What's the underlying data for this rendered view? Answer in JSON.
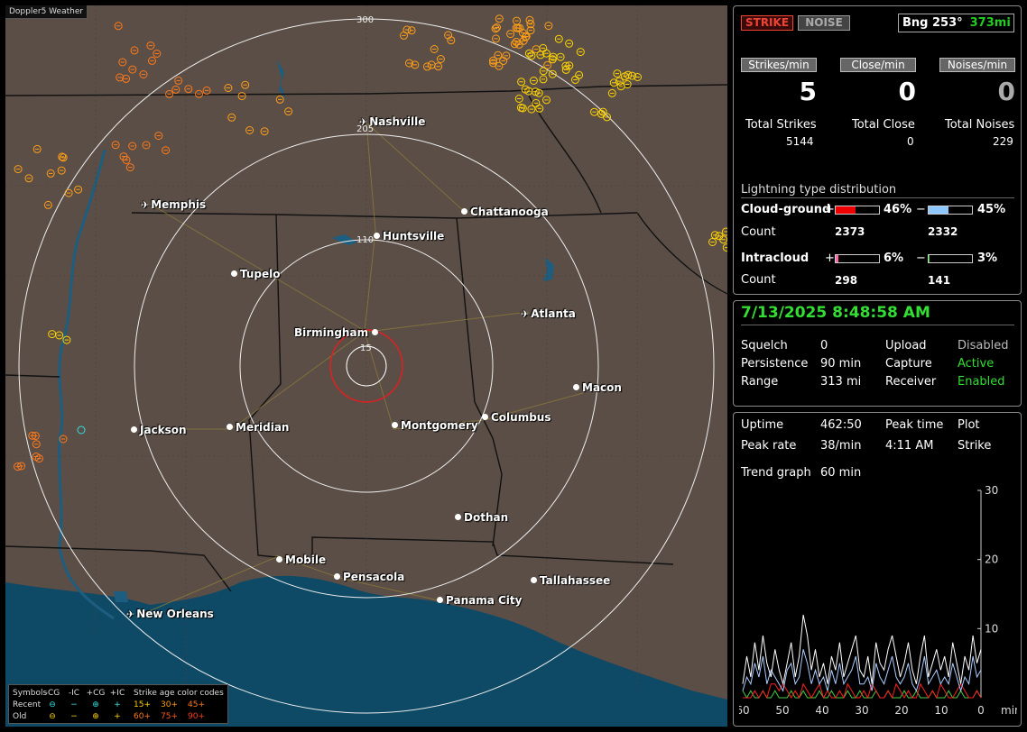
{
  "app_title": "Doppler5 Weather",
  "cities": {
    "nashville": "Nashville",
    "memphis": "Memphis",
    "chattanooga": "Chattanooga",
    "huntsville": "Huntsville",
    "tupelo": "Tupelo",
    "birmingham": "Birmingham",
    "atlanta": "Atlanta",
    "macon": "Macon",
    "jackson": "Jackson",
    "meridian": "Meridian",
    "montgomery": "Montgomery",
    "columbus": "Columbus",
    "dothan": "Dothan",
    "mobile": "Mobile",
    "pensacola": "Pensacola",
    "tallahassee": "Tallahassee",
    "panama_city": "Panama City",
    "new_orleans": "New Orleans"
  },
  "rings": {
    "r15": "15",
    "r110": "110",
    "r205": "205",
    "r300": "300"
  },
  "legend": {
    "header": [
      "Symbols",
      "-CG",
      "-IC",
      "+CG",
      "+IC",
      "Strike age color codes"
    ],
    "recent_label": "Recent",
    "old_label": "Old",
    "recent_ages": [
      "15+",
      "30+",
      "45+"
    ],
    "old_ages": [
      "60+",
      "75+",
      "90+"
    ],
    "symbols": {
      "neg_cg": "⊖",
      "neg_ic": "−",
      "pos_cg": "⊕",
      "pos_ic": "+"
    }
  },
  "colors": {
    "age15": "#ffd400",
    "age30": "#ff9e18",
    "age45": "#ff7a1a",
    "recent_sym": "#33e0e0",
    "old_sym": "#ffd400",
    "strike_dot": "#ff9e18"
  },
  "status": {
    "strike_btn": "STRIKE",
    "noise_btn": "NOISE",
    "bearing_label": "Bng 253°",
    "bearing_dist": "373mi"
  },
  "rates": {
    "strikes_per_min_label": "Strikes/min",
    "close_per_min_label": "Close/min",
    "noises_per_min_label": "Noises/min",
    "strikes_per_min": "5",
    "close_per_min": "0",
    "noises_per_min": "0",
    "total_strikes_label": "Total Strikes",
    "total_close_label": "Total Close",
    "total_noises_label": "Total Noises",
    "total_strikes": "5144",
    "total_close": "0",
    "total_noises": "229"
  },
  "distribution": {
    "title": "Lightning type distribution",
    "cg_label": "Cloud-ground",
    "ic_label": "Intracloud",
    "count_label": "Count",
    "plus": "+",
    "minus": "−",
    "cg_pos_pct": "46%",
    "cg_neg_pct": "45%",
    "ic_pos_pct": "6%",
    "ic_neg_pct": "3%",
    "cg_pos_frac": 0.46,
    "cg_neg_frac": 0.45,
    "ic_pos_frac": 0.06,
    "ic_neg_frac": 0.03,
    "cg_pos_count": "2373",
    "cg_neg_count": "2332",
    "ic_pos_count": "298",
    "ic_neg_count": "141"
  },
  "settings": {
    "datetime": "7/13/2025 8:48:58 AM",
    "squelch_label": "Squelch",
    "squelch": "0",
    "persistence_label": "Persistence",
    "persistence": "90 min",
    "range_label": "Range",
    "range": "313 mi",
    "upload_label": "Upload",
    "upload": "Disabled",
    "capture_label": "Capture",
    "capture": "Active",
    "receiver_label": "Receiver",
    "receiver": "Enabled"
  },
  "stats": {
    "uptime_label": "Uptime",
    "uptime": "462:50",
    "peak_time_label": "Peak time",
    "peak_time": "4:11 AM",
    "plot_label": "Plot",
    "plot": "Strike",
    "peak_rate_label": "Peak rate",
    "peak_rate": "38/min",
    "trend_label": "Trend graph",
    "trend": "60 min"
  },
  "chart_data": {
    "type": "line",
    "x_ticks": [
      "60",
      "50",
      "40",
      "30",
      "20",
      "10",
      "0"
    ],
    "x_unit": "min",
    "y_ticks": [
      "30",
      "20",
      "10"
    ],
    "ylim": [
      0,
      30
    ],
    "xlim": [
      60,
      0
    ],
    "series": [
      {
        "color": "#ffffff",
        "values": [
          2,
          6,
          3,
          8,
          4,
          9,
          5,
          3,
          7,
          4,
          2,
          5,
          8,
          3,
          6,
          12,
          9,
          4,
          7,
          3,
          5,
          2,
          6,
          4,
          8,
          3,
          5,
          7,
          9,
          4,
          3,
          6,
          2,
          8,
          5,
          4,
          7,
          9,
          6,
          3,
          5,
          8,
          4,
          2,
          6,
          9,
          3,
          5,
          7,
          4,
          6,
          3,
          8,
          5,
          2,
          6,
          4,
          9,
          5,
          7
        ]
      },
      {
        "color": "#aaccff",
        "values": [
          1,
          3,
          2,
          5,
          3,
          6,
          2,
          4,
          3,
          2,
          1,
          4,
          5,
          2,
          3,
          7,
          5,
          2,
          4,
          2,
          3,
          1,
          4,
          2,
          5,
          2,
          3,
          4,
          6,
          2,
          2,
          3,
          1,
          5,
          3,
          2,
          4,
          6,
          3,
          2,
          3,
          5,
          2,
          1,
          3,
          6,
          2,
          3,
          4,
          2,
          3,
          2,
          5,
          3,
          1,
          3,
          2,
          6,
          3,
          4
        ]
      },
      {
        "color": "#ff2020",
        "values": [
          0,
          0,
          0,
          1,
          0,
          1,
          0,
          2,
          2,
          1,
          2,
          1,
          0,
          1,
          0,
          2,
          1,
          0,
          1,
          2,
          0,
          1,
          0,
          0,
          1,
          0,
          2,
          1,
          0,
          0,
          1,
          0,
          2,
          1,
          0,
          0,
          1,
          0,
          2,
          1,
          0,
          1,
          0,
          0,
          2,
          1,
          0,
          1,
          0,
          2,
          1,
          0,
          0,
          1,
          2,
          1,
          0,
          0,
          1,
          0
        ]
      },
      {
        "color": "#44cc44",
        "values": [
          1,
          0,
          1,
          0,
          0,
          1,
          0,
          0,
          1,
          0,
          0,
          0,
          1,
          0,
          0,
          1,
          0,
          0,
          0,
          1,
          0,
          0,
          1,
          0,
          0,
          0,
          1,
          0,
          0,
          1,
          0,
          0,
          0,
          1,
          0,
          0,
          1,
          0,
          0,
          0,
          1,
          0,
          0,
          1,
          0,
          0,
          0,
          1,
          0,
          0,
          0,
          1,
          0,
          0,
          1,
          0,
          0,
          0,
          1,
          0
        ]
      }
    ]
  }
}
